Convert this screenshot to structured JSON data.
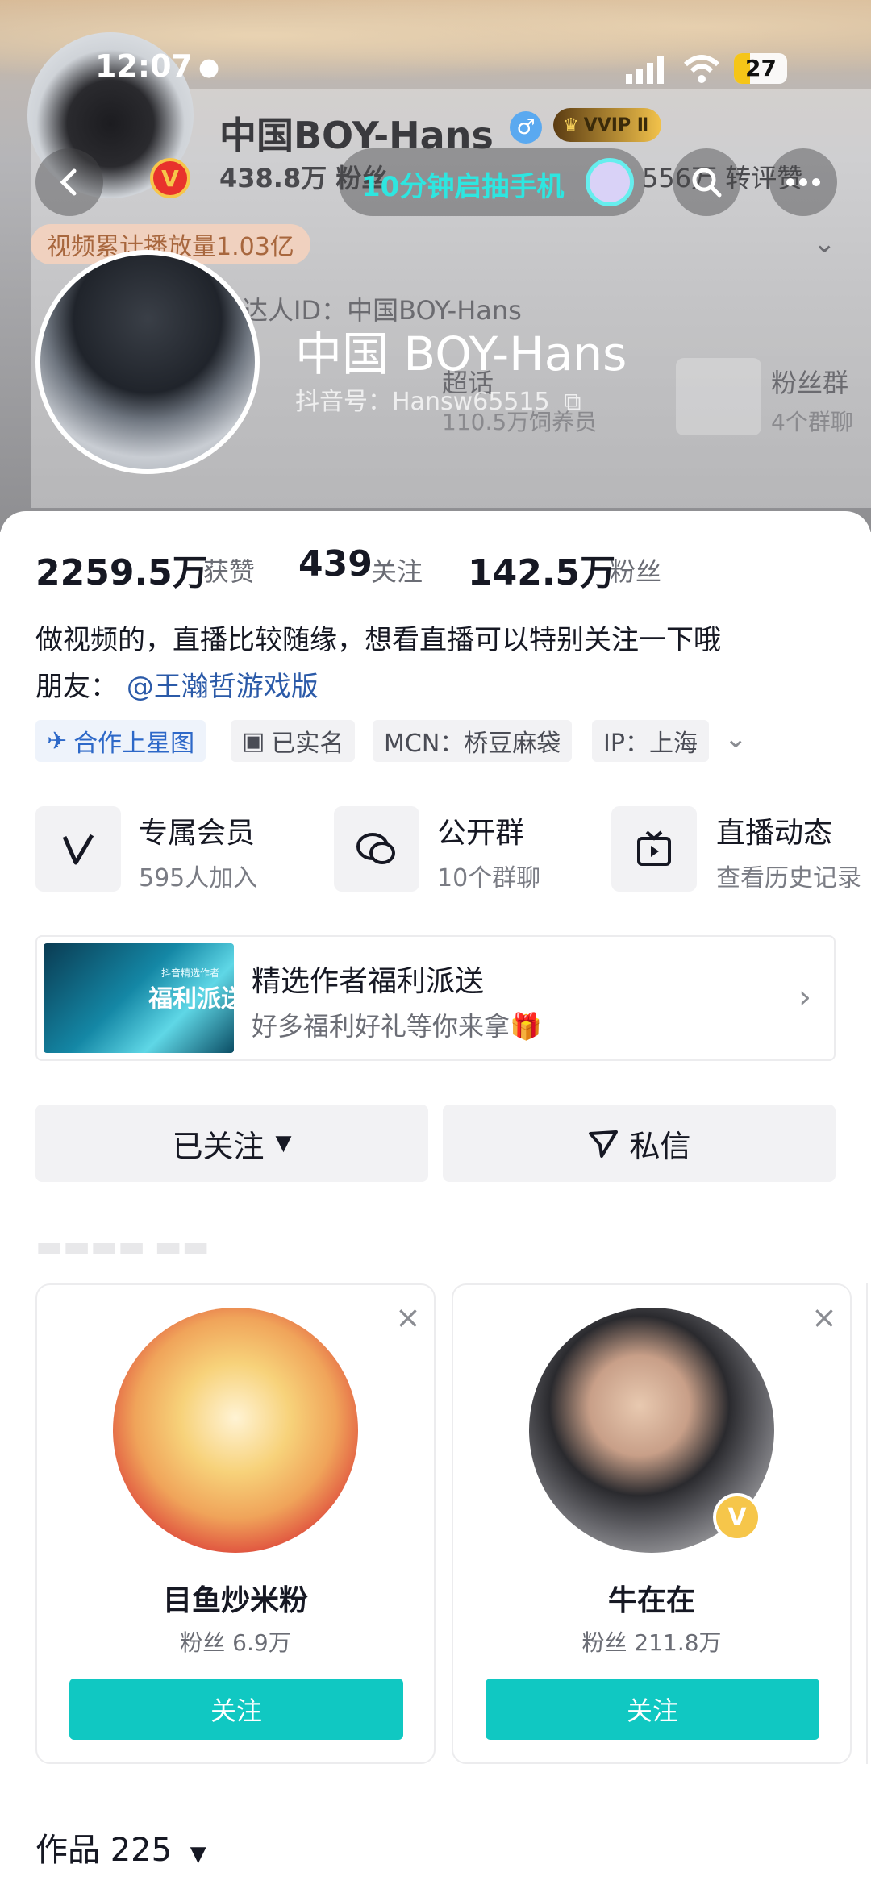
{
  "status_bar": {
    "time": "12:07",
    "battery": "27"
  },
  "background_profile": {
    "name": "中国BOY-Hans",
    "vip_label": "VVIP Ⅱ",
    "stats_line": "438.8万 粉丝",
    "stats_line2": "556万 转评赞",
    "play_count": "视频累计播放量1.03亿",
    "talent_id": "达人ID：中国BOY-Hans",
    "super_topic": "超话",
    "super_topic_sub": "110.5万饲养员",
    "fan_group": "粉丝群",
    "fan_group_sub": "4个群聊"
  },
  "nav": {
    "pill_text": "10分钟启抽手机"
  },
  "profile": {
    "name": "中国 BOY-Hans",
    "douyin_id": "抖音号：Hansw65515"
  },
  "stats": [
    {
      "value": "2259.5万",
      "label": "获赞"
    },
    {
      "value": "439",
      "label": "关注"
    },
    {
      "value": "142.5万",
      "label": "粉丝"
    }
  ],
  "bio": {
    "line1": "做视频的，直播比较随缘，想看直播可以特别关注一下哦",
    "line2_prefix": "朋友：",
    "mention": "@王瀚哲游戏版"
  },
  "tags": {
    "coop": "合作上星图",
    "verified": "已实名",
    "mcn": "MCN：桥豆麻袋",
    "ip": "IP：上海"
  },
  "features": [
    {
      "title": "专属会员",
      "sub": "595人加入"
    },
    {
      "title": "公开群",
      "sub": "10个群聊"
    },
    {
      "title": "直播动态",
      "sub": "查看历史记录"
    }
  ],
  "promo": {
    "title": "精选作者福利派送",
    "subtitle": "好多福利好礼等你来拿🎁",
    "image_text": "福利派送",
    "image_small": "抖音精选作者"
  },
  "actions": {
    "followed": "已关注",
    "message": "私信"
  },
  "recommendations": [
    {
      "name": "目鱼炒米粉",
      "fans": "粉丝 6.9万",
      "follow": "关注"
    },
    {
      "name": "牛在在",
      "fans": "粉丝 211.8万",
      "follow": "关注"
    }
  ],
  "works": {
    "label": "作品 225"
  },
  "colors": {
    "accent": "#10c8c2",
    "link": "#2b5aa8",
    "pill_text": "#2ee6e0"
  }
}
